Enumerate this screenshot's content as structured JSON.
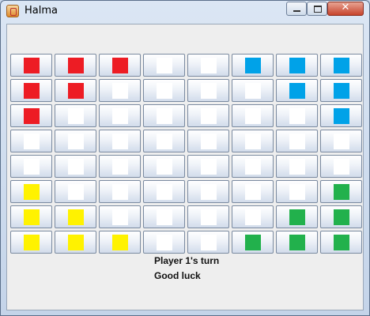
{
  "window": {
    "title": "Halma"
  },
  "colors": {
    "red": "#ed1c24",
    "blue": "#00a2e8",
    "yellow": "#fff200",
    "green": "#22b14c",
    "empty": "#ffffff"
  },
  "board": {
    "rows": [
      [
        "red",
        "red",
        "red",
        "empty",
        "empty",
        "blue",
        "blue",
        "blue"
      ],
      [
        "red",
        "red",
        "empty",
        "empty",
        "empty",
        "empty",
        "blue",
        "blue"
      ],
      [
        "red",
        "empty",
        "empty",
        "empty",
        "empty",
        "empty",
        "empty",
        "blue"
      ],
      [
        "empty",
        "empty",
        "empty",
        "empty",
        "empty",
        "empty",
        "empty",
        "empty"
      ],
      [
        "empty",
        "empty",
        "empty",
        "empty",
        "empty",
        "empty",
        "empty",
        "empty"
      ],
      [
        "yellow",
        "empty",
        "empty",
        "empty",
        "empty",
        "empty",
        "empty",
        "green"
      ],
      [
        "yellow",
        "yellow",
        "empty",
        "empty",
        "empty",
        "empty",
        "green",
        "green"
      ],
      [
        "yellow",
        "yellow",
        "yellow",
        "empty",
        "empty",
        "green",
        "green",
        "green"
      ]
    ]
  },
  "status": {
    "turn": "Player 1's turn",
    "message": "Good luck"
  }
}
